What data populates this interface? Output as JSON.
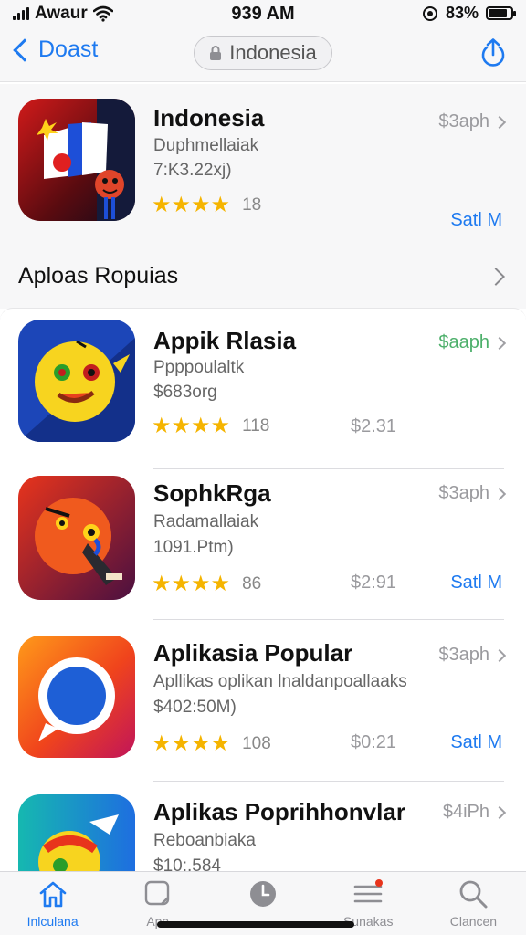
{
  "status_bar": {
    "carrier": "Awaur",
    "time": "939 AM",
    "battery": "83%",
    "battery_level": 0.83
  },
  "nav": {
    "back_label": "Doast",
    "location": "Indonesia"
  },
  "featured": {
    "title": "Indonesia",
    "subtitle": "Duphmellaiak",
    "detail": "7:K3.22xj)",
    "stars": "★★★★",
    "rating_count": "18",
    "price": "$3aph",
    "action": "Satl M"
  },
  "section": {
    "title": "Aploas Ropuias"
  },
  "apps": [
    {
      "title": "Appik Rlasia",
      "subtitle": "Ppppoulaltk",
      "detail": "$683org",
      "stars": "★★★★",
      "rating_count": "118",
      "price_top": "$aaph",
      "price_mid": "$2.31",
      "action": ""
    },
    {
      "title": "SophkRga",
      "subtitle": "Radamallaiak",
      "detail": "1091.Ptm)",
      "stars": "★★★★",
      "rating_count": "86",
      "price_top": "$3aph",
      "price_mid": "$2:91",
      "action": "Satl M"
    },
    {
      "title": "Aplikasia Popular",
      "subtitle": "Apllikas oplikan lnaldanpoallaaks",
      "detail": "$402:50M)",
      "stars": "★★★★",
      "rating_count": "108",
      "price_top": "$3aph",
      "price_mid": "$0:21",
      "action": "Satl M"
    },
    {
      "title": "Aplikas Poprihhonvlar",
      "subtitle": "Reboanbiaka",
      "detail": "$10:.584",
      "stars": "",
      "rating_count": "",
      "price_top": "$4iPh",
      "price_mid": "",
      "action": ""
    }
  ],
  "tabs": [
    {
      "label": "Inlculana",
      "icon": "home-icon"
    },
    {
      "label": "Apa",
      "icon": "apps-icon"
    },
    {
      "label": "",
      "icon": "clock-icon"
    },
    {
      "label": "Sunakas",
      "icon": "updates-icon"
    },
    {
      "label": "Clancen",
      "icon": "search-icon"
    }
  ],
  "colors": {
    "accent": "#1e7af0",
    "star": "#f5b400",
    "price_green": "#4caf6a"
  }
}
